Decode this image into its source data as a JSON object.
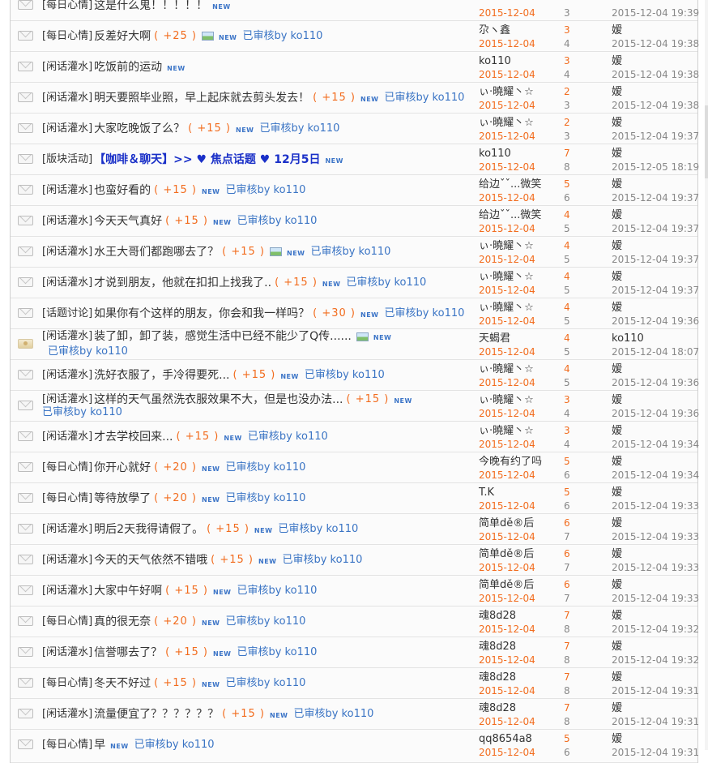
{
  "new_label": "NEW",
  "rows": [
    {
      "tag": "[每日心情]",
      "title": "这是什么鬼！！！！！",
      "bold": false,
      "reward": "",
      "image": false,
      "audit": "",
      "author": "",
      "post_date": "2015-12-04",
      "replies": "",
      "views": "3",
      "last_poster": "",
      "last_time": "2015-12-04 19:39",
      "avatar": false
    },
    {
      "tag": "[每日心情]",
      "title": "反差好大啊",
      "bold": false,
      "reward": "( +25 )",
      "image": true,
      "audit": "已审核by ko110",
      "author": "尕ヽ鑫",
      "post_date": "2015-12-04",
      "replies": "3",
      "views": "4",
      "last_poster": "嫒",
      "last_time": "2015-12-04 19:38",
      "avatar": false
    },
    {
      "tag": "[闲话灌水]",
      "title": "吃饭前的运动",
      "bold": false,
      "reward": "",
      "image": false,
      "audit": "",
      "author": "ko110",
      "post_date": "2015-12-04",
      "replies": "3",
      "views": "4",
      "last_poster": "嫒",
      "last_time": "2015-12-04 19:38",
      "avatar": false
    },
    {
      "tag": "[闲话灌水]",
      "title": "明天要照毕业照，早上起床就去剪头发去！",
      "bold": false,
      "reward": "( +15 )",
      "image": false,
      "audit": "已审核by ko110",
      "author": "ぃ·曉耀丶☆",
      "post_date": "2015-12-04",
      "replies": "2",
      "views": "3",
      "last_poster": "嫒",
      "last_time": "2015-12-04 19:38",
      "avatar": false
    },
    {
      "tag": "[闲话灌水]",
      "title": "大家吃晚饭了么？",
      "bold": false,
      "reward": "( +15 )",
      "image": false,
      "audit": "已审核by ko110",
      "author": "ぃ·曉耀丶☆",
      "post_date": "2015-12-04",
      "replies": "2",
      "views": "3",
      "last_poster": "嫒",
      "last_time": "2015-12-04 19:37",
      "avatar": false
    },
    {
      "tag": "[版块活动]",
      "title": "【咖啡＆聊天】>> ♥ 焦点话题 ♥ 12月5日",
      "bold": true,
      "reward": "",
      "image": false,
      "audit": "",
      "author": "ko110",
      "post_date": "2015-12-04",
      "replies": "7",
      "views": "8",
      "last_poster": "嫒",
      "last_time": "2015-12-05 18:19",
      "avatar": false
    },
    {
      "tag": "[闲话灌水]",
      "title": "也蛮好看的",
      "bold": false,
      "reward": "( +15 )",
      "image": false,
      "audit": "已审核by ko110",
      "author": "给边ˇˇ...微笑",
      "post_date": "2015-12-04",
      "replies": "5",
      "views": "6",
      "last_poster": "嫒",
      "last_time": "2015-12-04 19:37",
      "avatar": false
    },
    {
      "tag": "[闲话灌水]",
      "title": "今天天气真好",
      "bold": false,
      "reward": "( +15 )",
      "image": false,
      "audit": "已审核by ko110",
      "author": "给边ˇˇ...微笑",
      "post_date": "2015-12-04",
      "replies": "4",
      "views": "5",
      "last_poster": "嫒",
      "last_time": "2015-12-04 19:37",
      "avatar": false
    },
    {
      "tag": "[闲话灌水]",
      "title": "水王大哥们都跑哪去了？",
      "bold": false,
      "reward": "( +15 )",
      "image": true,
      "audit": "已审核by ko110",
      "author": "ぃ·曉耀丶☆",
      "post_date": "2015-12-04",
      "replies": "4",
      "views": "5",
      "last_poster": "嫒",
      "last_time": "2015-12-04 19:37",
      "avatar": false
    },
    {
      "tag": "[闲话灌水]",
      "title": "才说到朋友，他就在扣扣上找我了..",
      "bold": false,
      "reward": "( +15 )",
      "image": false,
      "audit": "已审核by ko110",
      "author": "ぃ·曉耀丶☆",
      "post_date": "2015-12-04",
      "replies": "4",
      "views": "5",
      "last_poster": "嫒",
      "last_time": "2015-12-04 19:37",
      "avatar": false
    },
    {
      "tag": "[话题讨论]",
      "title": "如果你有个这样的朋友，你会和我一样吗？",
      "bold": false,
      "reward": "( +30 )",
      "image": false,
      "audit": "已审核by ko110",
      "author": "ぃ·曉耀丶☆",
      "post_date": "2015-12-04",
      "replies": "4",
      "views": "5",
      "last_poster": "嫒",
      "last_time": "2015-12-04 19:36",
      "avatar": false
    },
    {
      "tag": "[闲话灌水]",
      "title": "装了卸，卸了装，感觉生活中已经不能少了Q传......",
      "bold": false,
      "reward": "",
      "image": true,
      "audit": "已审核by ko110",
      "author": "天蝎君",
      "post_date": "2015-12-04",
      "replies": "4",
      "views": "5",
      "last_poster": "ko110",
      "last_time": "2015-12-04 18:07",
      "avatar": true
    },
    {
      "tag": "[闲话灌水]",
      "title": "洗好衣服了，手冷得要死...",
      "bold": false,
      "reward": "( +15 )",
      "image": false,
      "audit": "已审核by ko110",
      "author": "ぃ·曉耀丶☆",
      "post_date": "2015-12-04",
      "replies": "4",
      "views": "5",
      "last_poster": "嫒",
      "last_time": "2015-12-04 19:36",
      "avatar": false
    },
    {
      "tag": "[闲话灌水]",
      "title": "这样的天气虽然洗衣服效果不大，但是也没办法...",
      "bold": false,
      "reward": "( +15 )",
      "image": false,
      "audit": "已审核by ko110",
      "author": "ぃ·曉耀丶☆",
      "post_date": "2015-12-04",
      "replies": "3",
      "views": "4",
      "last_poster": "嫒",
      "last_time": "2015-12-04 19:36",
      "avatar": false,
      "wrap": true
    },
    {
      "tag": "[闲话灌水]",
      "title": "才去学校回来...",
      "bold": false,
      "reward": "( +15 )",
      "image": false,
      "audit": "已审核by ko110",
      "author": "ぃ·曉耀丶☆",
      "post_date": "2015-12-04",
      "replies": "3",
      "views": "4",
      "last_poster": "嫒",
      "last_time": "2015-12-04 19:34",
      "avatar": false
    },
    {
      "tag": "[每日心情]",
      "title": "你开心就好",
      "bold": false,
      "reward": "( +20 )",
      "image": false,
      "audit": "已审核by ko110",
      "author": "今晚有约了吗",
      "post_date": "2015-12-04",
      "replies": "5",
      "views": "6",
      "last_poster": "嫒",
      "last_time": "2015-12-04 19:34",
      "avatar": false
    },
    {
      "tag": "[每日心情]",
      "title": "等待放學了",
      "bold": false,
      "reward": "( +20 )",
      "image": false,
      "audit": "已审核by ko110",
      "author": "T.K",
      "post_date": "2015-12-04",
      "replies": "5",
      "views": "6",
      "last_poster": "嫒",
      "last_time": "2015-12-04 19:33",
      "avatar": false
    },
    {
      "tag": "[闲话灌水]",
      "title": "明后2天我得请假了。",
      "bold": false,
      "reward": "( +15 )",
      "image": false,
      "audit": "已审核by ko110",
      "author": "简单dě®后",
      "post_date": "2015-12-04",
      "replies": "6",
      "views": "7",
      "last_poster": "嫒",
      "last_time": "2015-12-04 19:33",
      "avatar": false
    },
    {
      "tag": "[闲话灌水]",
      "title": "今天的天气依然不错哦",
      "bold": false,
      "reward": "( +15 )",
      "image": false,
      "audit": "已审核by ko110",
      "author": "简单dě®后",
      "post_date": "2015-12-04",
      "replies": "6",
      "views": "7",
      "last_poster": "嫒",
      "last_time": "2015-12-04 19:33",
      "avatar": false
    },
    {
      "tag": "[闲话灌水]",
      "title": "大家中午好啊",
      "bold": false,
      "reward": "( +15 )",
      "image": false,
      "audit": "已审核by ko110",
      "author": "简单dě®后",
      "post_date": "2015-12-04",
      "replies": "6",
      "views": "7",
      "last_poster": "嫒",
      "last_time": "2015-12-04 19:33",
      "avatar": false
    },
    {
      "tag": "[每日心情]",
      "title": "真的很无奈",
      "bold": false,
      "reward": "( +20 )",
      "image": false,
      "audit": "已审核by ko110",
      "author": "魂8d28",
      "post_date": "2015-12-04",
      "replies": "7",
      "views": "8",
      "last_poster": "嫒",
      "last_time": "2015-12-04 19:32",
      "avatar": false
    },
    {
      "tag": "[闲话灌水]",
      "title": "信誉哪去了？",
      "bold": false,
      "reward": "( +15 )",
      "image": false,
      "audit": "已审核by ko110",
      "author": "魂8d28",
      "post_date": "2015-12-04",
      "replies": "7",
      "views": "8",
      "last_poster": "嫒",
      "last_time": "2015-12-04 19:32",
      "avatar": false
    },
    {
      "tag": "[每日心情]",
      "title": "冬天不好过",
      "bold": false,
      "reward": "( +15 )",
      "image": false,
      "audit": "已审核by ko110",
      "author": "魂8d28",
      "post_date": "2015-12-04",
      "replies": "7",
      "views": "8",
      "last_poster": "嫒",
      "last_time": "2015-12-04 19:31",
      "avatar": false
    },
    {
      "tag": "[闲话灌水]",
      "title": "流量便宜了？？？？？？",
      "bold": false,
      "reward": "( +15 )",
      "image": false,
      "audit": "已审核by ko110",
      "author": "魂8d28",
      "post_date": "2015-12-04",
      "replies": "7",
      "views": "8",
      "last_poster": "嫒",
      "last_time": "2015-12-04 19:31",
      "avatar": false
    },
    {
      "tag": "[每日心情]",
      "title": "早",
      "bold": false,
      "reward": "",
      "image": false,
      "audit": "已审核by ko110",
      "author": "qq8654a8",
      "post_date": "2015-12-04",
      "replies": "5",
      "views": "6",
      "last_poster": "嫒",
      "last_time": "2015-12-04 19:31",
      "avatar": false
    }
  ]
}
